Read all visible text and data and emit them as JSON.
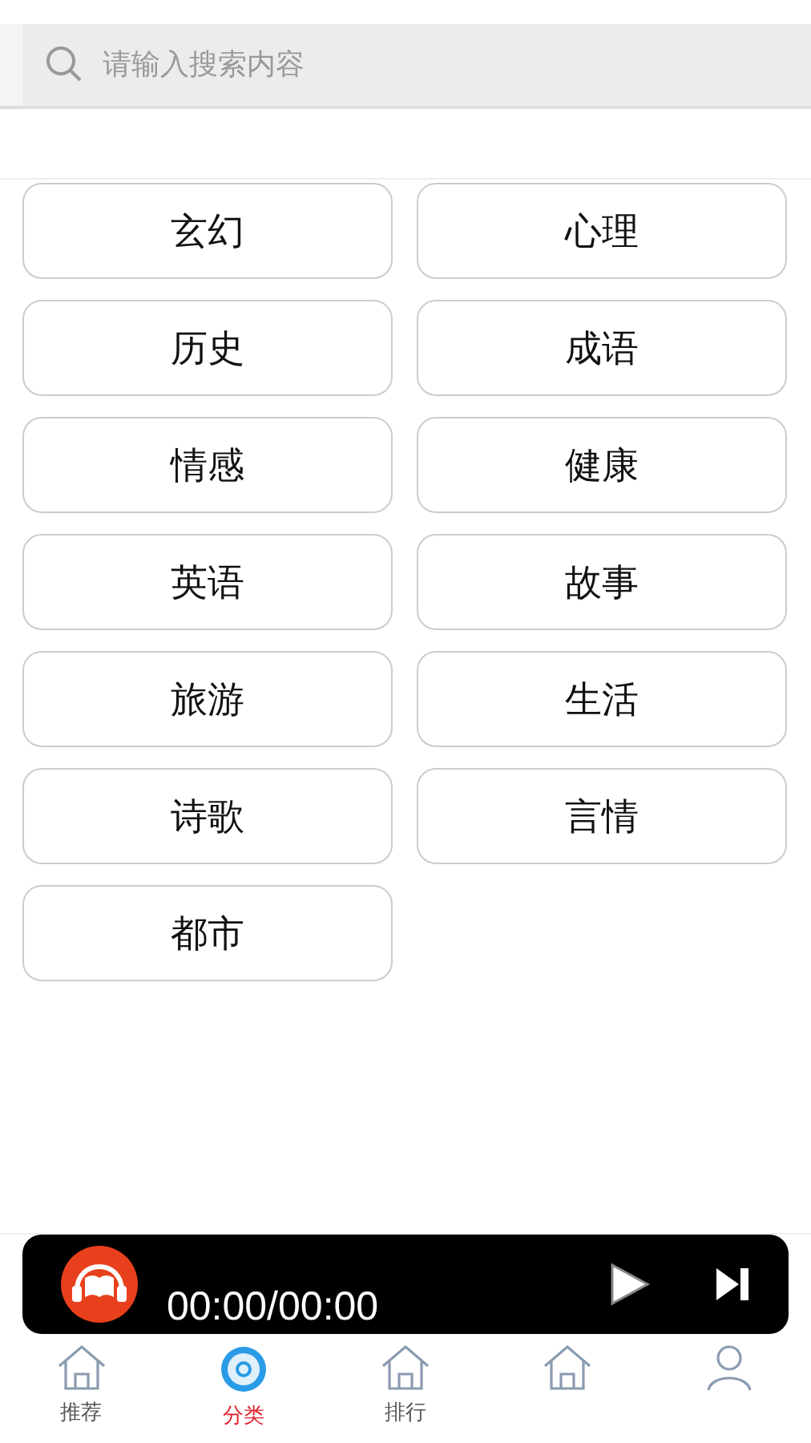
{
  "search": {
    "placeholder": "请输入搜索内容"
  },
  "categories": [
    "玄幻",
    "心理",
    "历史",
    "成语",
    "情感",
    "健康",
    "英语",
    "故事",
    "旅游",
    "生活",
    "诗歌",
    "言情",
    "都市"
  ],
  "player": {
    "time": "00:00/00:00"
  },
  "tabs": [
    {
      "kind": "house",
      "label": "推荐",
      "selected": false
    },
    {
      "kind": "disc",
      "label": "分类",
      "selected": true
    },
    {
      "kind": "house",
      "label": "排行",
      "selected": false
    },
    {
      "kind": "house",
      "selected": false
    },
    {
      "kind": "person",
      "selected": false
    }
  ]
}
